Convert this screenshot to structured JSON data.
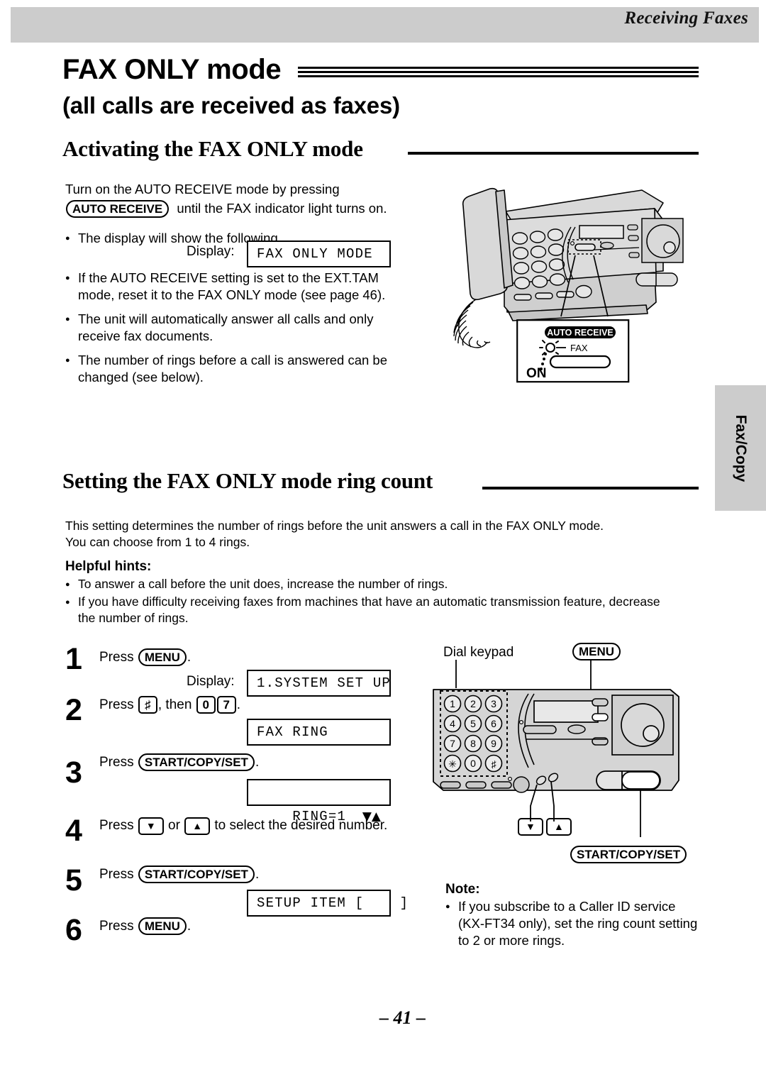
{
  "header": {
    "running_head": "Receiving Faxes"
  },
  "title": {
    "main": "FAX ONLY mode",
    "sub": "(all calls are received as faxes)"
  },
  "section1": {
    "heading": "Activating the FAX ONLY mode",
    "intro_line1": "Turn on the AUTO RECEIVE mode by pressing",
    "intro_key": "AUTO RECEIVE",
    "intro_line2_tail": "until the FAX indicator light turns on.",
    "bullet1": "The display will show the following.",
    "display_label": "Display:",
    "display_value": "FAX ONLY MODE",
    "bullet2_line1": "If the AUTO RECEIVE setting is set to the EXT.TAM",
    "bullet2_line2": "mode, reset it to the FAX ONLY mode (see page 46).",
    "bullet3_line1": "The unit will automatically answer all calls and only",
    "bullet3_line2": "receive fax documents.",
    "bullet4_line1": "The number of rings before a call is answered can be",
    "bullet4_line2": "changed (see below)."
  },
  "illustration_top": {
    "callout_badge": "AUTO RECEIVE",
    "callout_fax": "FAX",
    "callout_on": "ON"
  },
  "section2": {
    "heading": "Setting the FAX ONLY mode ring count",
    "intro_line1": "This setting determines the number of rings before the unit answers a call in the FAX ONLY mode.",
    "intro_line2": "You can choose from 1 to 4 rings.",
    "hints_title": "Helpful hints:",
    "hint1": "To answer a call before the unit does, increase the number of rings.",
    "hint2_line1": "If you have difficulty receiving faxes from machines that have an automatic transmission feature, decrease",
    "hint2_line2": "the number of rings."
  },
  "steps": [
    {
      "num": "1",
      "text_pre": "Press",
      "key": "MENU",
      "text_post": ".",
      "display_label": "Display:",
      "display_value": "1.SYSTEM SET UP"
    },
    {
      "num": "2",
      "text_pre": "Press",
      "key": "♯",
      "text_mid": ", then",
      "key2": "0",
      "key3": "7",
      "text_post": ".",
      "display_value": "FAX RING"
    },
    {
      "num": "3",
      "text_pre": "Press",
      "key": "START/COPY/SET",
      "text_post": ".",
      "display_value": "RING=1",
      "display_right": "▼▲"
    },
    {
      "num": "4",
      "text_pre": "Press",
      "key": "▼",
      "text_mid": "or",
      "key2": "▲",
      "text_post": "to select the desired number."
    },
    {
      "num": "5",
      "text_pre": "Press",
      "key": "START/COPY/SET",
      "text_post": ".",
      "display_value": "SETUP ITEM [    ]"
    },
    {
      "num": "6",
      "text_pre": "Press",
      "key": "MENU",
      "text_post": "."
    }
  ],
  "illustration_bottom": {
    "label_keypad": "Dial keypad",
    "label_menu": "MENU",
    "label_start": "START/COPY/SET",
    "label_down": "▼",
    "label_up": "▲",
    "keypad_keys": [
      "1",
      "2",
      "3",
      "4",
      "5",
      "6",
      "7",
      "8",
      "9",
      "✳",
      "0",
      "♯"
    ]
  },
  "note": {
    "title": "Note:",
    "line1": "If you subscribe to a Caller ID service",
    "line2": "(KX-FT34 only), set the ring count setting",
    "line3": "to 2 or more rings."
  },
  "side_tab": {
    "label": "Fax/Copy"
  },
  "footer": {
    "page_number": "– 41 –"
  },
  "colors": {
    "band": "#cccccc",
    "ink": "#000000",
    "device": "#d9d9d9"
  }
}
